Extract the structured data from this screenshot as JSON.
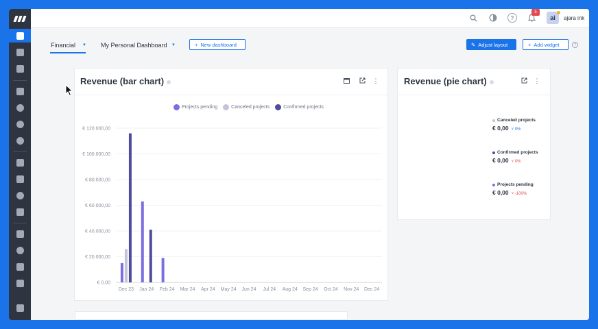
{
  "colors": {
    "accent": "#1a73e8",
    "pending": "#7b6fe0",
    "canceled": "#c3c4d8",
    "confirmed": "#4e4c9c",
    "negative": "#e5484d"
  },
  "topbar": {
    "company": "ajara ink",
    "avatar_initials": "ai",
    "notification_count": "5",
    "icons": [
      "search-icon",
      "theme-icon",
      "help-icon",
      "bell-icon"
    ]
  },
  "subbar": {
    "tabs": [
      {
        "label": "Financial"
      },
      {
        "label": "My Personal Dashboard"
      }
    ],
    "new_dashboard_label": "New dashboard",
    "adjust_layout_label": "Adjust layout",
    "add_widget_label": "Add widget"
  },
  "bar_card": {
    "title": "Revenue (bar chart)"
  },
  "pie_card": {
    "title": "Revenue (pie chart)",
    "items": [
      {
        "label": "Canceled projects",
        "value": "€ 0,00",
        "change": "0%",
        "color": "#c3c4d8",
        "change_color": "#1a73e8"
      },
      {
        "label": "Confirmed projects",
        "value": "€ 0,00",
        "change": "0%",
        "color": "#4e4c9c",
        "change_color": "#e5484d"
      },
      {
        "label": "Projects pending",
        "value": "€ 0,00",
        "change": "-100%",
        "color": "#7b6fe0",
        "change_color": "#e5484d"
      }
    ]
  },
  "chart_data": {
    "type": "bar",
    "categories": [
      "Dec 23",
      "Jan 24",
      "Feb 24",
      "Mar 24",
      "Apr 24",
      "May 24",
      "Jun 24",
      "Jul 24",
      "Aug 24",
      "Sep 24",
      "Oct 24",
      "Nov 24",
      "Dec 24"
    ],
    "series": [
      {
        "name": "Projects pending",
        "values": [
          15000,
          63000,
          19000,
          0,
          0,
          0,
          0,
          0,
          0,
          0,
          0,
          0,
          0
        ]
      },
      {
        "name": "Canceled projects",
        "values": [
          26000,
          0,
          0,
          0,
          0,
          0,
          0,
          0,
          0,
          0,
          0,
          0,
          0
        ]
      },
      {
        "name": "Confirmed projects",
        "values": [
          116000,
          41000,
          0,
          0,
          0,
          0,
          0,
          0,
          0,
          0,
          0,
          0,
          0
        ]
      }
    ],
    "y_ticks": [
      "€ 0.00",
      "€ 20.000,00",
      "€ 40.000,00",
      "€ 60.000,00",
      "€ 80.000,00",
      "€ 100.000,00",
      "€ 120.000,00"
    ],
    "ylim": [
      0,
      120000
    ],
    "legend": "top"
  }
}
